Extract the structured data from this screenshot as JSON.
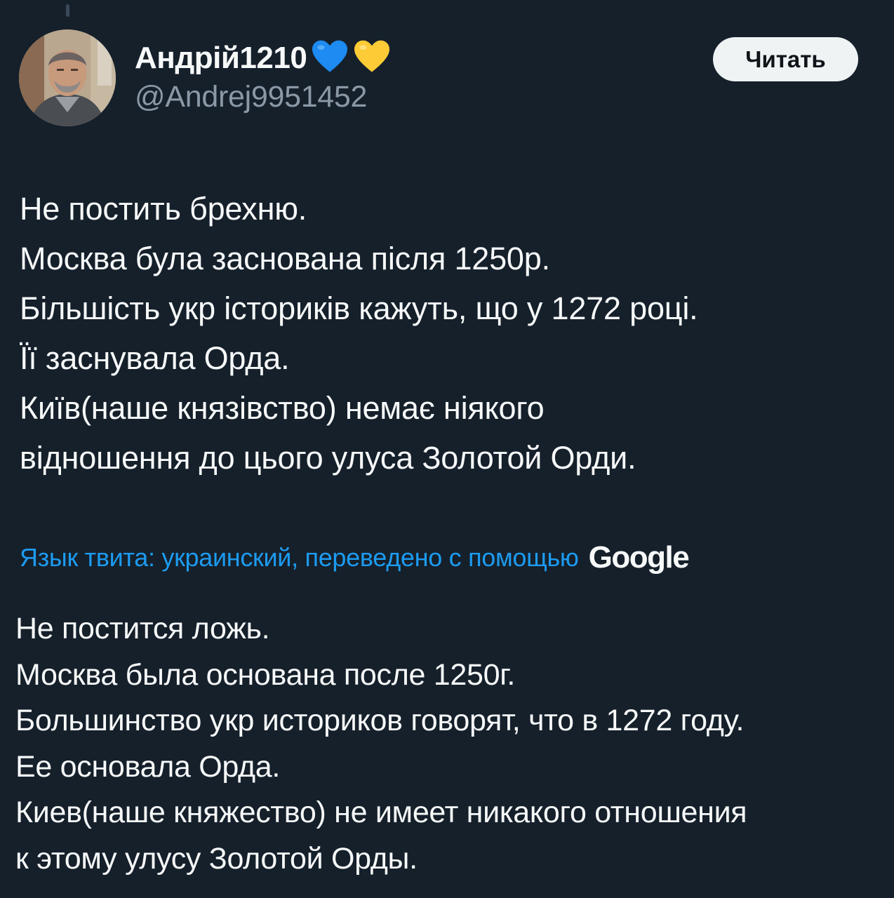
{
  "tweet": {
    "author": {
      "display_name": "Андрій1210",
      "handle": "@Andrej9951452",
      "badges": [
        "blue-heart-icon",
        "yellow-heart-icon"
      ]
    },
    "follow_button_label": "Читать",
    "original_lines": [
      "Не постить брехню.",
      "Москва була заснована після 1250р.",
      "Більшість укр істориків кажуть, що у 1272 році.",
      "Її заснувала Орда.",
      "Київ(наше князівство) немає ніякого",
      "відношення до цього улуса Золотой Орди."
    ],
    "translation": {
      "label": "Язык твита: украинский, переведено с помощью",
      "provider": "Google"
    },
    "translated_lines": [
      "Не постится ложь.",
      "Москва была основана после 1250г.",
      "Большинство укр историков говорят, что в 1272 году.",
      "Ее основала Орда.",
      "Киев(наше княжество) не имеет никакого отношения",
      "к этому улусу Золотой Орды."
    ]
  },
  "colors": {
    "background": "#15202b",
    "text_primary": "#f7f9f9",
    "text_secondary": "#8b98a5",
    "link": "#1d9bf0",
    "button_bg": "#eff3f4",
    "heart_blue": "#1d8bf1",
    "heart_yellow": "#fdcb35"
  }
}
